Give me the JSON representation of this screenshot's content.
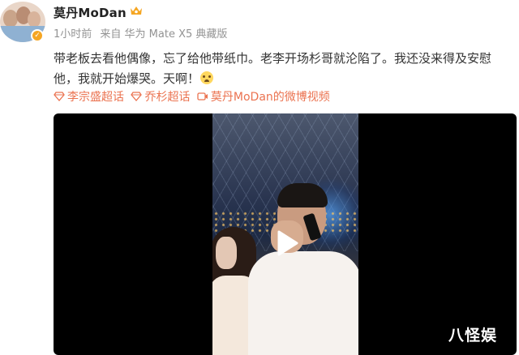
{
  "post": {
    "username": "莫丹MoDan",
    "time": "1小时前",
    "source": "来自 华为 Mate X5 典藏版",
    "text": "带老板去看他偶像，忘了给他带纸巾。老李开场杉哥就沦陷了。我还没来得及安慰他，我就开始爆哭。天啊！",
    "topics": [
      {
        "label": "李宗盛超话",
        "icon": "diamond-icon"
      },
      {
        "label": "乔杉超话",
        "icon": "diamond-icon"
      },
      {
        "label": "莫丹MoDan的微博视频",
        "icon": "video-link-icon"
      }
    ]
  },
  "watermark": "八怪娱",
  "colors": {
    "link": "#eb7350",
    "meta": "#939393",
    "verified_badge": "#f5a623"
  }
}
